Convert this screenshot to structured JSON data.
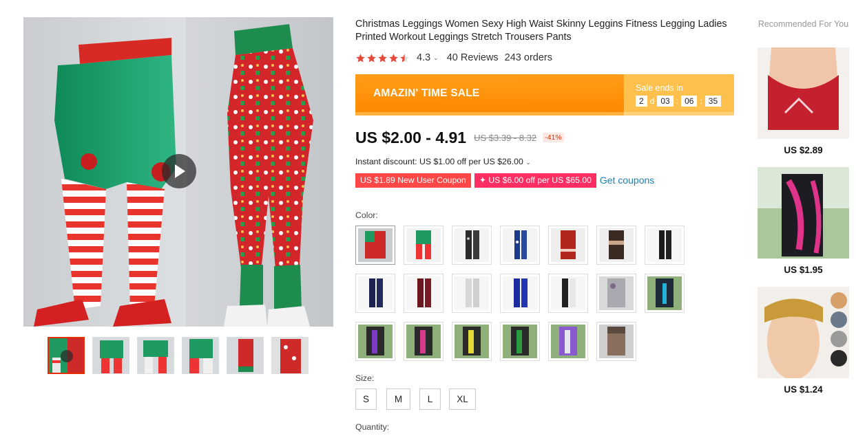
{
  "product": {
    "title": "Christmas Leggings Women Sexy High Waist Skinny Leggins Fitness Legging Ladies Printed Workout Leggings Stretch Trousers Pants",
    "rating": "4.3",
    "rating_stars": 4.3,
    "reviews": "40 Reviews",
    "orders": "243 orders"
  },
  "sale": {
    "label": "AMAZIN' TIME SALE",
    "ends_in": "Sale ends in",
    "countdown": {
      "days": "2",
      "d": "d",
      "hours": "03",
      "minutes": "06",
      "seconds": "35",
      "sep": ":"
    }
  },
  "price": {
    "current": "US $2.00 - 4.91",
    "original": "US $3.39 - 8.32",
    "discount": "-41%"
  },
  "instant_discount": "Instant discount: US $1.00 off per US $26.00",
  "coupons": {
    "new_user": "US $1.89 New User Coupon",
    "store": "✦ US $6.00 off per US $65.00",
    "get_link": "Get coupons"
  },
  "color_label": "Color:",
  "size_label": "Size:",
  "sizes": [
    "S",
    "M",
    "L",
    "XL"
  ],
  "quantity_label": "Quantity:",
  "recommended": {
    "title": "Recommended For You",
    "items": [
      {
        "price": "US $2.89"
      },
      {
        "price": "US $1.95"
      },
      {
        "price": "US $1.24"
      }
    ]
  },
  "colors": {
    "accent": "#e62e04",
    "sale_orange": "#ff8a00",
    "coupon_red": "#ff4747",
    "coupon_pink": "#ff2e62",
    "link_blue": "#1a7fb5"
  }
}
